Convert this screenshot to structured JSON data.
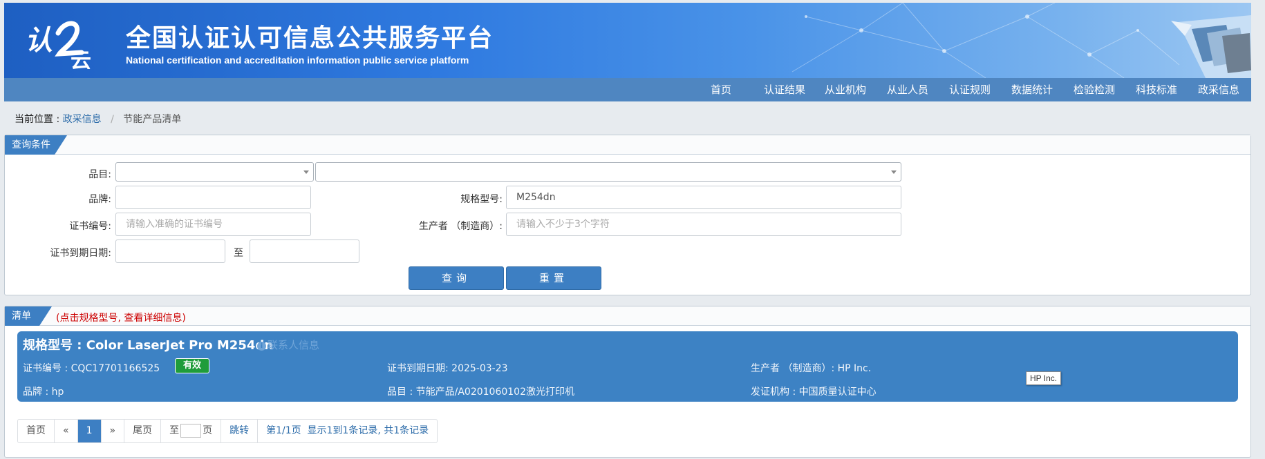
{
  "header": {
    "title": "全国认证认可信息公共服务平台",
    "subtitle": "National certification and accreditation information public service platform"
  },
  "nav": [
    "首页",
    "认证结果",
    "从业机构",
    "从业人员",
    "认证规则",
    "数据统计",
    "检验检测",
    "科技标准",
    "政采信息"
  ],
  "breadcrumb": {
    "label": "当前位置 :",
    "link": "政采信息",
    "sep": "/",
    "current": "节能产品清单"
  },
  "query": {
    "title": "查询条件",
    "category_label": "品目:",
    "brand_label": "品牌:",
    "model_label": "规格型号:",
    "model_value": "M254dn",
    "cert_label": "证书编号:",
    "cert_placeholder": "请输入准确的证书编号",
    "maker_label": "生产者 （制造商）:",
    "maker_placeholder": "请输入不少于3个字符",
    "expiry_label": "证书到期日期:",
    "to_label": "至",
    "search_button": "查询",
    "reset_button": "重置"
  },
  "list": {
    "title": "清单",
    "hint": "(点击规格型号, 查看详细信息)"
  },
  "result": {
    "model": "规格型号 : Color LaserJet Pro M254dn",
    "contact": "联系人信息",
    "cert_no": "证书编号 : CQC17701166525",
    "status": "有效",
    "expiry": "证书到期日期: 2025-03-23",
    "maker": "生产者 （制造商）: HP Inc.",
    "brand": "品牌 : hp",
    "category": "品目 : 节能产品/A0201060102激光打印机",
    "issuer": "发证机构 : 中国质量认证中心",
    "tooltip": "HP Inc."
  },
  "pager": {
    "first": "首页",
    "prev": "«",
    "page": "1",
    "next": "»",
    "last": "尾页",
    "to": "至",
    "page_unit": "页",
    "jump": "跳转",
    "page_info": "第1/1页",
    "record_info": "显示1到1条记录, 共1条记录"
  },
  "colors": {
    "primary": "#3d7fc3",
    "nav": "#4f86c1",
    "valid": "#1f9c3a",
    "hint": "#cc0000"
  }
}
